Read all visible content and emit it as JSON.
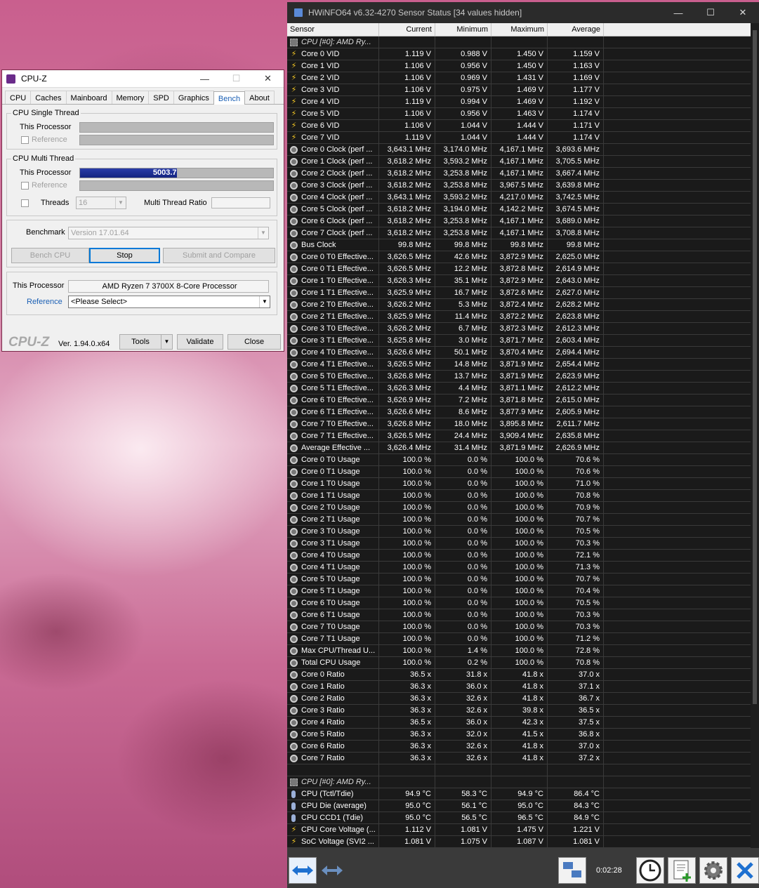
{
  "cpuz": {
    "title": "CPU-Z",
    "tabs": [
      "CPU",
      "Caches",
      "Mainboard",
      "Memory",
      "SPD",
      "Graphics",
      "Bench",
      "About"
    ],
    "active_tab": "Bench",
    "single_thread": {
      "group_title": "CPU Single Thread",
      "this_processor": "This Processor",
      "reference": "Reference"
    },
    "multi_thread": {
      "group_title": "CPU Multi Thread",
      "this_processor": "This Processor",
      "score": "5003.7",
      "score_fraction": 0.5,
      "reference": "Reference",
      "threads_label": "Threads",
      "threads_value": "16",
      "ratio_label": "Multi Thread Ratio"
    },
    "benchmark_label": "Benchmark",
    "benchmark_version": "Version 17.01.64",
    "bench_cpu": "Bench CPU",
    "stop": "Stop",
    "submit": "Submit and Compare",
    "this_processor_label": "This Processor",
    "processor_name": "AMD Ryzen 7 3700X 8-Core Processor",
    "reference_label": "Reference",
    "reference_select": "<Please Select>",
    "logo": "CPU-Z",
    "version": "Ver. 1.94.0.x64",
    "tools": "Tools",
    "validate": "Validate",
    "close": "Close"
  },
  "hwinfo": {
    "title": "HWiNFO64 v6.32-4270 Sensor Status [34 values hidden]",
    "columns": [
      "Sensor",
      "Current",
      "Minimum",
      "Maximum",
      "Average"
    ],
    "rows": [
      {
        "icon": "chip",
        "name": "CPU [#0]: AMD Ry...",
        "header": true
      },
      {
        "icon": "volt",
        "name": "Core 0 VID",
        "v": [
          "1.119 V",
          "0.988 V",
          "1.450 V",
          "1.159 V"
        ]
      },
      {
        "icon": "volt",
        "name": "Core 1 VID",
        "v": [
          "1.106 V",
          "0.956 V",
          "1.450 V",
          "1.163 V"
        ]
      },
      {
        "icon": "volt",
        "name": "Core 2 VID",
        "v": [
          "1.106 V",
          "0.969 V",
          "1.431 V",
          "1.169 V"
        ]
      },
      {
        "icon": "volt",
        "name": "Core 3 VID",
        "v": [
          "1.106 V",
          "0.975 V",
          "1.469 V",
          "1.177 V"
        ]
      },
      {
        "icon": "volt",
        "name": "Core 4 VID",
        "v": [
          "1.119 V",
          "0.994 V",
          "1.469 V",
          "1.192 V"
        ]
      },
      {
        "icon": "volt",
        "name": "Core 5 VID",
        "v": [
          "1.106 V",
          "0.956 V",
          "1.463 V",
          "1.174 V"
        ]
      },
      {
        "icon": "volt",
        "name": "Core 6 VID",
        "v": [
          "1.106 V",
          "1.044 V",
          "1.444 V",
          "1.171 V"
        ]
      },
      {
        "icon": "volt",
        "name": "Core 7 VID",
        "v": [
          "1.119 V",
          "1.044 V",
          "1.444 V",
          "1.174 V"
        ]
      },
      {
        "icon": "clock",
        "name": "Core 0 Clock (perf ...",
        "v": [
          "3,643.1 MHz",
          "3,174.0 MHz",
          "4,167.1 MHz",
          "3,693.6 MHz"
        ]
      },
      {
        "icon": "clock",
        "name": "Core 1 Clock (perf ...",
        "v": [
          "3,618.2 MHz",
          "3,593.2 MHz",
          "4,167.1 MHz",
          "3,705.5 MHz"
        ]
      },
      {
        "icon": "clock",
        "name": "Core 2 Clock (perf ...",
        "v": [
          "3,618.2 MHz",
          "3,253.8 MHz",
          "4,167.1 MHz",
          "3,667.4 MHz"
        ]
      },
      {
        "icon": "clock",
        "name": "Core 3 Clock (perf ...",
        "v": [
          "3,618.2 MHz",
          "3,253.8 MHz",
          "3,967.5 MHz",
          "3,639.8 MHz"
        ]
      },
      {
        "icon": "clock",
        "name": "Core 4 Clock (perf ...",
        "v": [
          "3,643.1 MHz",
          "3,593.2 MHz",
          "4,217.0 MHz",
          "3,742.5 MHz"
        ]
      },
      {
        "icon": "clock",
        "name": "Core 5 Clock (perf ...",
        "v": [
          "3,618.2 MHz",
          "3,194.0 MHz",
          "4,142.2 MHz",
          "3,674.5 MHz"
        ]
      },
      {
        "icon": "clock",
        "name": "Core 6 Clock (perf ...",
        "v": [
          "3,618.2 MHz",
          "3,253.8 MHz",
          "4,167.1 MHz",
          "3,689.0 MHz"
        ]
      },
      {
        "icon": "clock",
        "name": "Core 7 Clock (perf ...",
        "v": [
          "3,618.2 MHz",
          "3,253.8 MHz",
          "4,167.1 MHz",
          "3,708.8 MHz"
        ]
      },
      {
        "icon": "clock",
        "name": "Bus Clock",
        "v": [
          "99.8 MHz",
          "99.8 MHz",
          "99.8 MHz",
          "99.8 MHz"
        ]
      },
      {
        "icon": "clock",
        "name": "Core 0 T0 Effective...",
        "v": [
          "3,626.5 MHz",
          "42.6 MHz",
          "3,872.9 MHz",
          "2,625.0 MHz"
        ]
      },
      {
        "icon": "clock",
        "name": "Core 0 T1 Effective...",
        "v": [
          "3,626.5 MHz",
          "12.2 MHz",
          "3,872.8 MHz",
          "2,614.9 MHz"
        ]
      },
      {
        "icon": "clock",
        "name": "Core 1 T0 Effective...",
        "v": [
          "3,626.3 MHz",
          "35.1 MHz",
          "3,872.9 MHz",
          "2,643.0 MHz"
        ]
      },
      {
        "icon": "clock",
        "name": "Core 1 T1 Effective...",
        "v": [
          "3,625.9 MHz",
          "16.7 MHz",
          "3,872.6 MHz",
          "2,627.0 MHz"
        ]
      },
      {
        "icon": "clock",
        "name": "Core 2 T0 Effective...",
        "v": [
          "3,626.2 MHz",
          "5.3 MHz",
          "3,872.4 MHz",
          "2,628.2 MHz"
        ]
      },
      {
        "icon": "clock",
        "name": "Core 2 T1 Effective...",
        "v": [
          "3,625.9 MHz",
          "11.4 MHz",
          "3,872.2 MHz",
          "2,623.8 MHz"
        ]
      },
      {
        "icon": "clock",
        "name": "Core 3 T0 Effective...",
        "v": [
          "3,626.2 MHz",
          "6.7 MHz",
          "3,872.3 MHz",
          "2,612.3 MHz"
        ]
      },
      {
        "icon": "clock",
        "name": "Core 3 T1 Effective...",
        "v": [
          "3,625.8 MHz",
          "3.0 MHz",
          "3,871.7 MHz",
          "2,603.4 MHz"
        ]
      },
      {
        "icon": "clock",
        "name": "Core 4 T0 Effective...",
        "v": [
          "3,626.6 MHz",
          "50.1 MHz",
          "3,870.4 MHz",
          "2,694.4 MHz"
        ]
      },
      {
        "icon": "clock",
        "name": "Core 4 T1 Effective...",
        "v": [
          "3,626.5 MHz",
          "14.8 MHz",
          "3,871.9 MHz",
          "2,654.4 MHz"
        ]
      },
      {
        "icon": "clock",
        "name": "Core 5 T0 Effective...",
        "v": [
          "3,626.8 MHz",
          "13.7 MHz",
          "3,871.9 MHz",
          "2,623.9 MHz"
        ]
      },
      {
        "icon": "clock",
        "name": "Core 5 T1 Effective...",
        "v": [
          "3,626.3 MHz",
          "4.4 MHz",
          "3,871.1 MHz",
          "2,612.2 MHz"
        ]
      },
      {
        "icon": "clock",
        "name": "Core 6 T0 Effective...",
        "v": [
          "3,626.9 MHz",
          "7.2 MHz",
          "3,871.8 MHz",
          "2,615.0 MHz"
        ]
      },
      {
        "icon": "clock",
        "name": "Core 6 T1 Effective...",
        "v": [
          "3,626.6 MHz",
          "8.6 MHz",
          "3,877.9 MHz",
          "2,605.9 MHz"
        ]
      },
      {
        "icon": "clock",
        "name": "Core 7 T0 Effective...",
        "v": [
          "3,626.8 MHz",
          "18.0 MHz",
          "3,895.8 MHz",
          "2,611.7 MHz"
        ]
      },
      {
        "icon": "clock",
        "name": "Core 7 T1 Effective...",
        "v": [
          "3,626.5 MHz",
          "24.4 MHz",
          "3,909.4 MHz",
          "2,635.8 MHz"
        ]
      },
      {
        "icon": "clock",
        "name": "Average Effective ...",
        "v": [
          "3,626.4 MHz",
          "31.4 MHz",
          "3,871.9 MHz",
          "2,626.9 MHz"
        ]
      },
      {
        "icon": "clock",
        "name": "Core 0 T0 Usage",
        "v": [
          "100.0 %",
          "0.0 %",
          "100.0 %",
          "70.6 %"
        ]
      },
      {
        "icon": "clock",
        "name": "Core 0 T1 Usage",
        "v": [
          "100.0 %",
          "0.0 %",
          "100.0 %",
          "70.6 %"
        ]
      },
      {
        "icon": "clock",
        "name": "Core 1 T0 Usage",
        "v": [
          "100.0 %",
          "0.0 %",
          "100.0 %",
          "71.0 %"
        ]
      },
      {
        "icon": "clock",
        "name": "Core 1 T1 Usage",
        "v": [
          "100.0 %",
          "0.0 %",
          "100.0 %",
          "70.8 %"
        ]
      },
      {
        "icon": "clock",
        "name": "Core 2 T0 Usage",
        "v": [
          "100.0 %",
          "0.0 %",
          "100.0 %",
          "70.9 %"
        ]
      },
      {
        "icon": "clock",
        "name": "Core 2 T1 Usage",
        "v": [
          "100.0 %",
          "0.0 %",
          "100.0 %",
          "70.7 %"
        ]
      },
      {
        "icon": "clock",
        "name": "Core 3 T0 Usage",
        "v": [
          "100.0 %",
          "0.0 %",
          "100.0 %",
          "70.5 %"
        ]
      },
      {
        "icon": "clock",
        "name": "Core 3 T1 Usage",
        "v": [
          "100.0 %",
          "0.0 %",
          "100.0 %",
          "70.3 %"
        ]
      },
      {
        "icon": "clock",
        "name": "Core 4 T0 Usage",
        "v": [
          "100.0 %",
          "0.0 %",
          "100.0 %",
          "72.1 %"
        ]
      },
      {
        "icon": "clock",
        "name": "Core 4 T1 Usage",
        "v": [
          "100.0 %",
          "0.0 %",
          "100.0 %",
          "71.3 %"
        ]
      },
      {
        "icon": "clock",
        "name": "Core 5 T0 Usage",
        "v": [
          "100.0 %",
          "0.0 %",
          "100.0 %",
          "70.7 %"
        ]
      },
      {
        "icon": "clock",
        "name": "Core 5 T1 Usage",
        "v": [
          "100.0 %",
          "0.0 %",
          "100.0 %",
          "70.4 %"
        ]
      },
      {
        "icon": "clock",
        "name": "Core 6 T0 Usage",
        "v": [
          "100.0 %",
          "0.0 %",
          "100.0 %",
          "70.5 %"
        ]
      },
      {
        "icon": "clock",
        "name": "Core 6 T1 Usage",
        "v": [
          "100.0 %",
          "0.0 %",
          "100.0 %",
          "70.3 %"
        ]
      },
      {
        "icon": "clock",
        "name": "Core 7 T0 Usage",
        "v": [
          "100.0 %",
          "0.0 %",
          "100.0 %",
          "70.3 %"
        ]
      },
      {
        "icon": "clock",
        "name": "Core 7 T1 Usage",
        "v": [
          "100.0 %",
          "0.0 %",
          "100.0 %",
          "71.2 %"
        ]
      },
      {
        "icon": "clock",
        "name": "Max CPU/Thread U...",
        "v": [
          "100.0 %",
          "1.4 %",
          "100.0 %",
          "72.8 %"
        ]
      },
      {
        "icon": "clock",
        "name": "Total CPU Usage",
        "v": [
          "100.0 %",
          "0.2 %",
          "100.0 %",
          "70.8 %"
        ]
      },
      {
        "icon": "clock",
        "name": "Core 0 Ratio",
        "v": [
          "36.5 x",
          "31.8 x",
          "41.8 x",
          "37.0 x"
        ]
      },
      {
        "icon": "clock",
        "name": "Core 1 Ratio",
        "v": [
          "36.3 x",
          "36.0 x",
          "41.8 x",
          "37.1 x"
        ]
      },
      {
        "icon": "clock",
        "name": "Core 2 Ratio",
        "v": [
          "36.3 x",
          "32.6 x",
          "41.8 x",
          "36.7 x"
        ]
      },
      {
        "icon": "clock",
        "name": "Core 3 Ratio",
        "v": [
          "36.3 x",
          "32.6 x",
          "39.8 x",
          "36.5 x"
        ]
      },
      {
        "icon": "clock",
        "name": "Core 4 Ratio",
        "v": [
          "36.5 x",
          "36.0 x",
          "42.3 x",
          "37.5 x"
        ]
      },
      {
        "icon": "clock",
        "name": "Core 5 Ratio",
        "v": [
          "36.3 x",
          "32.0 x",
          "41.5 x",
          "36.8 x"
        ]
      },
      {
        "icon": "clock",
        "name": "Core 6 Ratio",
        "v": [
          "36.3 x",
          "32.6 x",
          "41.8 x",
          "37.0 x"
        ]
      },
      {
        "icon": "clock",
        "name": "Core 7 Ratio",
        "v": [
          "36.3 x",
          "32.6 x",
          "41.8 x",
          "37.2 x"
        ]
      },
      {
        "icon": "none",
        "name": "",
        "spacer": true
      },
      {
        "icon": "chip",
        "name": "CPU [#0]: AMD Ry...",
        "header": true
      },
      {
        "icon": "temp",
        "name": "CPU (Tctl/Tdie)",
        "v": [
          "94.9 °C",
          "58.3 °C",
          "94.9 °C",
          "86.4 °C"
        ]
      },
      {
        "icon": "temp",
        "name": "CPU Die (average)",
        "v": [
          "95.0 °C",
          "56.1 °C",
          "95.0 °C",
          "84.3 °C"
        ]
      },
      {
        "icon": "temp",
        "name": "CPU CCD1 (Tdie)",
        "v": [
          "95.0 °C",
          "56.5 °C",
          "96.5 °C",
          "84.9 °C"
        ]
      },
      {
        "icon": "volt",
        "name": "CPU Core Voltage (...",
        "v": [
          "1.112 V",
          "1.081 V",
          "1.475 V",
          "1.221 V"
        ]
      },
      {
        "icon": "volt",
        "name": "SoC Voltage (SVI2 ...",
        "v": [
          "1.081 V",
          "1.075 V",
          "1.087 V",
          "1.081 V"
        ]
      }
    ],
    "timer": "0:02:28"
  }
}
